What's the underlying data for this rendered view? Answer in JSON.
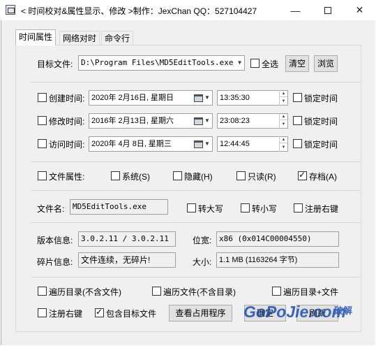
{
  "window": {
    "title": "< 时间校对&属性显示、修改 >制作：JexChan  QQ：527104427",
    "min_glyph": "—",
    "close_glyph": "✕"
  },
  "tabs": [
    "时间属性",
    "网络对时",
    "命令行"
  ],
  "target": {
    "label": "目标文件:",
    "path": "D:\\Program Files\\MD5EditTools.exe",
    "select_all_label": "全选",
    "clear_label": "清空",
    "browse_label": "浏览"
  },
  "times": [
    {
      "label": "创建时间:",
      "date": "2020年 2月16日, 星期日",
      "time": "13:35:30",
      "lock_label": "锁定时间"
    },
    {
      "label": "修改时间:",
      "date": "2016年 2月13日, 星期六",
      "time": "23:08:23",
      "lock_label": "锁定时间"
    },
    {
      "label": "访问时间:",
      "date": "2020年 4月 8日, 星期三",
      "time": "12:44:45",
      "lock_label": "锁定时间"
    }
  ],
  "attributes": {
    "label": "文件属性:",
    "system": "系统(S)",
    "hidden": "隐藏(H)",
    "readonly": "只读(R)",
    "archive": "存档(A)",
    "archive_checked": true
  },
  "filename": {
    "label": "文件名:",
    "value": "MD5EditTools.exe",
    "upper_label": "转大写",
    "lower_label": "转小写",
    "register_label": "注册右键"
  },
  "info": {
    "version_label": "版本信息:",
    "version_value": "3.0.2.11 / 3.0.2.11",
    "bitness_label": "位宽:",
    "bitness_value": "x86 (0x014C00004550)",
    "fragment_label": "碎片信息:",
    "fragment_value": "文件连续，无碎片!",
    "size_label": "大小:",
    "size_value": "1.1 MB (1163264 字节)"
  },
  "options": {
    "traverse_no_files": "遍历目录(不含文件)",
    "traverse_no_dirs": "遍历文件(不含目录)",
    "traverse_both": "遍历目录+文件",
    "register_right": "注册右键",
    "include_target": "包含目标文件",
    "include_target_checked": true,
    "view_process": "查看占用程序",
    "ok": "确定",
    "refresh": "刷新"
  },
  "watermark": {
    "main": "GoPoJie.com",
    "sub": "破解"
  }
}
